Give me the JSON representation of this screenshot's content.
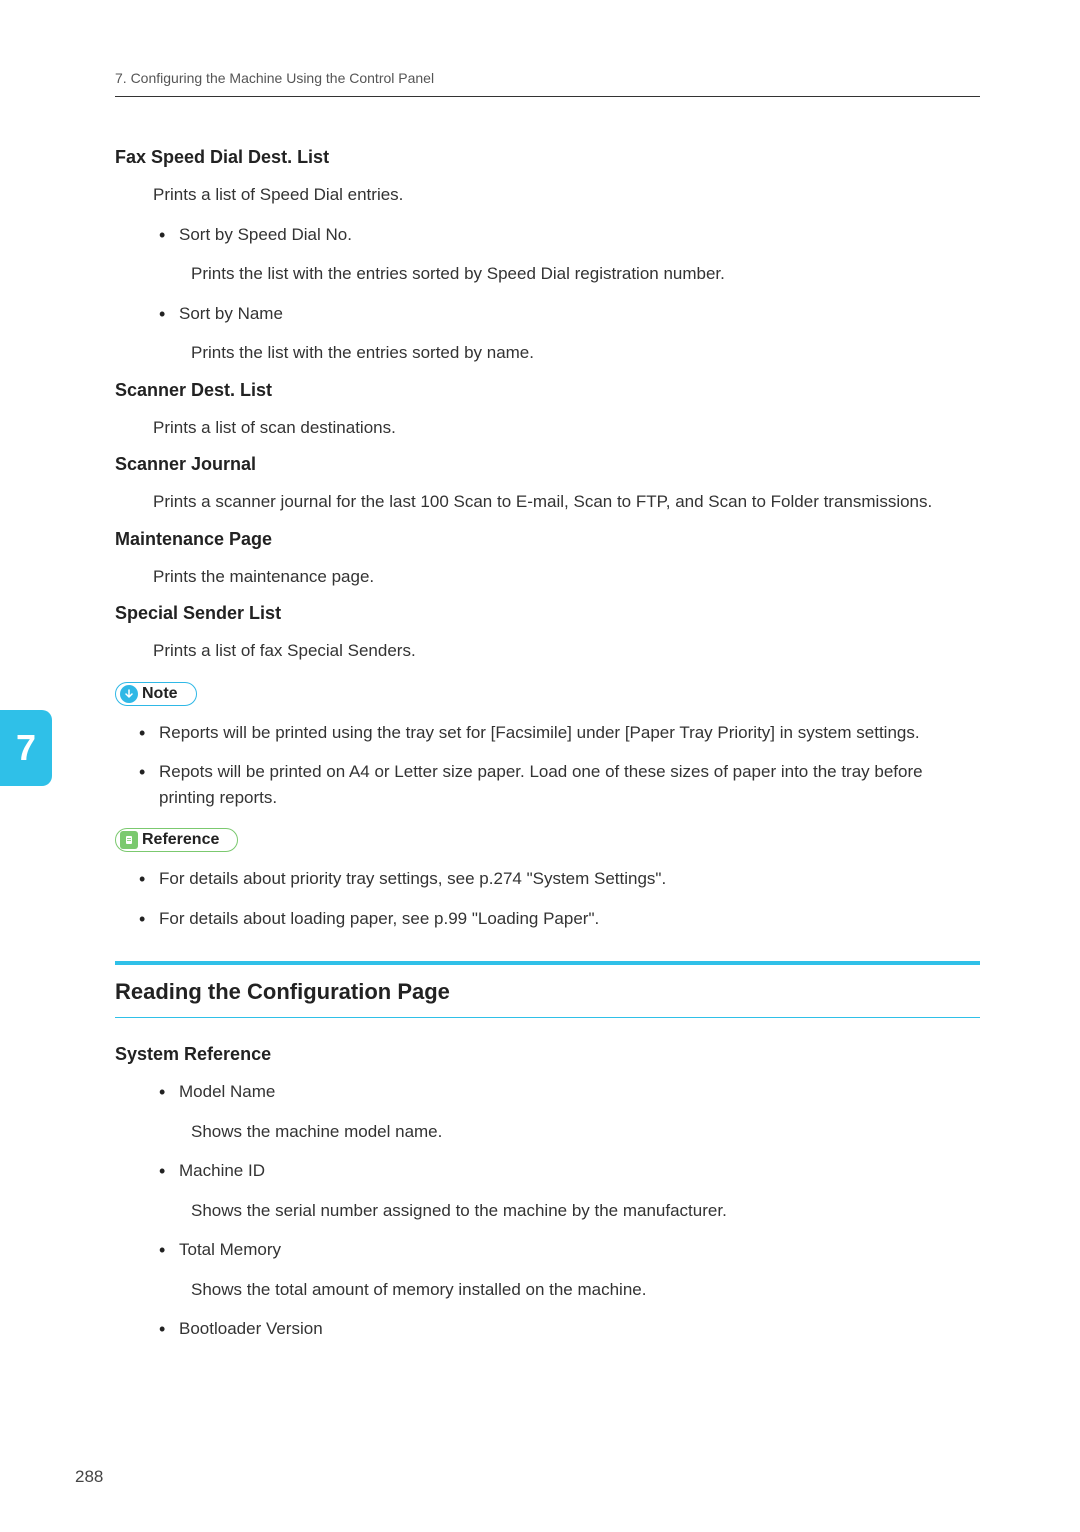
{
  "header": {
    "breadcrumb": "7. Configuring the Machine Using the Control Panel"
  },
  "chapterTab": "7",
  "pageNumber": "288",
  "sections": {
    "faxSpeedDial": {
      "title": "Fax Speed Dial Dest. List",
      "desc": "Prints a list of Speed Dial entries.",
      "item1": "Sort by Speed Dial No.",
      "item1desc": "Prints the list with the entries sorted by Speed Dial registration number.",
      "item2": "Sort by Name",
      "item2desc": "Prints the list with the entries sorted by name."
    },
    "scannerDest": {
      "title": "Scanner Dest. List",
      "desc": "Prints a list of scan destinations."
    },
    "scannerJournal": {
      "title": "Scanner Journal",
      "desc": "Prints a scanner journal for the last 100 Scan to E-mail, Scan to FTP, and Scan to Folder transmissions."
    },
    "maintenance": {
      "title": "Maintenance Page",
      "desc": "Prints the maintenance page."
    },
    "specialSender": {
      "title": "Special Sender List",
      "desc": "Prints a list of fax Special Senders."
    },
    "noteLabel": "Note",
    "noteItems": {
      "n1": "Reports will be printed using the tray set for [Facsimile] under [Paper Tray Priority] in system settings.",
      "n2": "Repots will be printed on A4 or Letter size paper. Load one of these sizes of paper into the tray before printing reports."
    },
    "refLabel": "Reference",
    "refItems": {
      "r1": "For details about priority tray settings, see p.274 \"System Settings\".",
      "r2": "For details about loading paper, see p.99 \"Loading Paper\"."
    },
    "h2": "Reading the Configuration Page",
    "systemRef": {
      "title": "System Reference",
      "i1": "Model Name",
      "i1d": "Shows the machine model name.",
      "i2": "Machine ID",
      "i2d": "Shows the serial number assigned to the machine by the manufacturer.",
      "i3": "Total Memory",
      "i3d": "Shows the total amount of memory installed on the machine.",
      "i4": "Bootloader Version"
    }
  }
}
